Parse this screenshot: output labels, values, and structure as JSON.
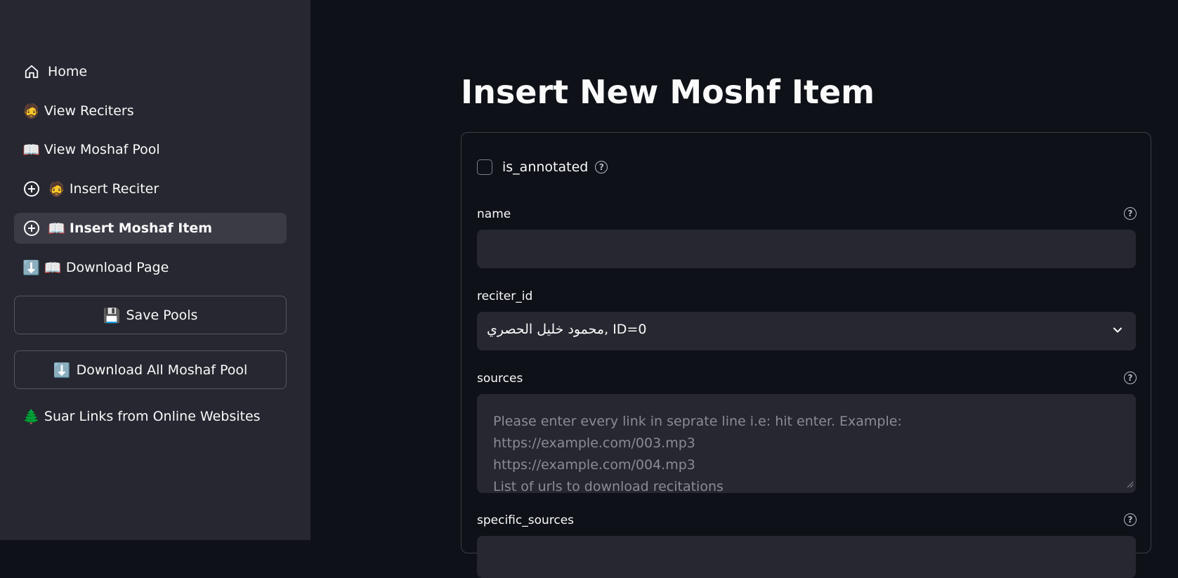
{
  "sidebar": {
    "items": [
      {
        "label": "Home",
        "icon": "home-icon"
      },
      {
        "label": "View Reciters",
        "emoji": "🧔"
      },
      {
        "label": "View Moshaf Pool",
        "emoji": "📖"
      },
      {
        "label": "Insert Reciter",
        "icon": "plus-circle-icon",
        "emoji": "🧔"
      },
      {
        "label": "Insert Moshaf Item",
        "icon": "plus-circle-icon",
        "emoji": "📖",
        "active": true
      },
      {
        "label": "Download Page",
        "emoji": "⬇️",
        "emoji2": "📖"
      }
    ],
    "save_pools": {
      "emoji": "💾",
      "label": "Save Pools"
    },
    "download_all": {
      "emoji": "⬇️",
      "label": "Download All Moshaf Pool"
    },
    "suar_links": {
      "emoji": "🌲",
      "label": "Suar Links from Online Websites"
    }
  },
  "main": {
    "title": "Insert New Moshf Item",
    "form": {
      "is_annotated": {
        "label": "is_annotated",
        "checked": false
      },
      "name": {
        "label": "name",
        "value": ""
      },
      "reciter_id": {
        "label": "reciter_id",
        "value": "محمود خليل الحصري, ID=0"
      },
      "sources": {
        "label": "sources",
        "placeholder": "Please enter every link in seprate line i.e: hit enter. Example:\nhttps://example.com/003.mp3\nhttps://example.com/004.mp3\nList of urls to download recitations"
      },
      "specific_sources": {
        "label": "specific_sources"
      }
    }
  },
  "colors": {
    "background": "#0e1117",
    "sidebar": "#262730",
    "active_item": "#3a3b45",
    "input": "#262730",
    "text": "#fafafa",
    "placeholder": "#8a8c93"
  }
}
